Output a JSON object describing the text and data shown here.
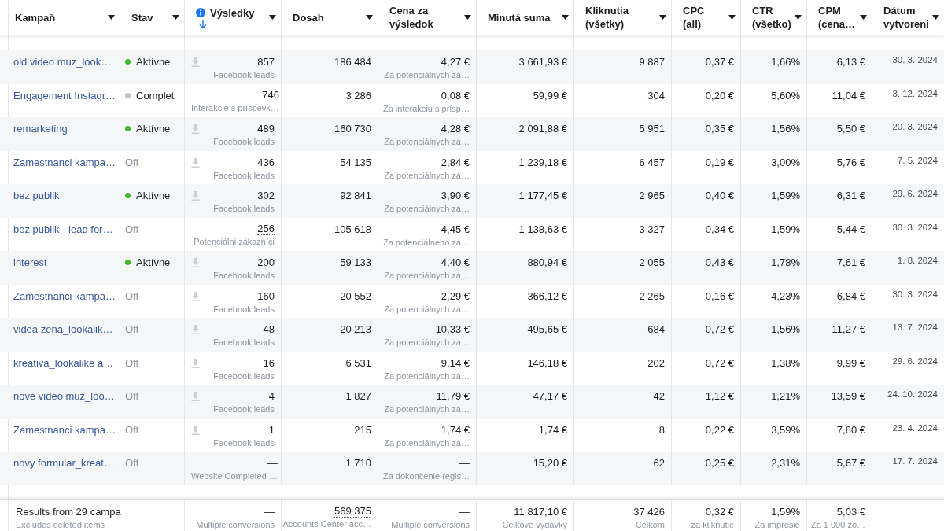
{
  "columns": [
    {
      "label": "Kampaň",
      "sorted": false
    },
    {
      "label": "Stav",
      "sorted": false
    },
    {
      "label": "Výsledky",
      "sorted": true
    },
    {
      "label": "Dosah",
      "sorted": false
    },
    {
      "label": "Cena za\nvýsledok",
      "sorted": false
    },
    {
      "label": "Minutá suma",
      "sorted": false
    },
    {
      "label": "Kliknutia\n(všetky)",
      "sorted": false
    },
    {
      "label": "CPC (all)",
      "sorted": false
    },
    {
      "label": "CTR\n(všetko)",
      "sorted": false
    },
    {
      "label": "CPM\n(cena…",
      "sorted": false
    },
    {
      "label": "Dátum\nvytvoreni",
      "sorted": false
    }
  ],
  "rows": [
    {
      "name": "old video muz_look…",
      "status": {
        "label": "Aktívne",
        "kind": "active"
      },
      "results": {
        "value": "857",
        "label": "Facebook leads",
        "download": true,
        "dotted": false
      },
      "reach": "186 484",
      "cost": {
        "value": "4,27 €",
        "label": "Za potenciálnych zá…"
      },
      "spent": "3 661,93 €",
      "clicks": "9 887",
      "cpc": "0,37 €",
      "ctr": "1,66%",
      "cpm": "6,13 €",
      "date": "30. 3. 2024"
    },
    {
      "name": "Engagement Instagr…",
      "status": {
        "label": "Complet",
        "kind": "completed"
      },
      "results": {
        "value": "746",
        "label": "Interakcie s príspevk…",
        "download": false,
        "dotted": true
      },
      "reach": "3 286",
      "cost": {
        "value": "0,08 €",
        "label": "Za interakciu s prísp…"
      },
      "spent": "59,99 €",
      "clicks": "304",
      "cpc": "0,20 €",
      "ctr": "5,60%",
      "cpm": "11,04 €",
      "date": "3. 12. 2024"
    },
    {
      "name": "remarketing",
      "status": {
        "label": "Aktívne",
        "kind": "active"
      },
      "results": {
        "value": "489",
        "label": "Facebook leads",
        "download": true,
        "dotted": false
      },
      "reach": "160 730",
      "cost": {
        "value": "4,28 €",
        "label": "Za potenciálnych zá…"
      },
      "spent": "2 091,88 €",
      "clicks": "5 951",
      "cpc": "0,35 €",
      "ctr": "1,56%",
      "cpm": "5,50 €",
      "date": "20. 3. 2024"
    },
    {
      "name": "Zamestnanci kampa…",
      "status": {
        "label": "Off",
        "kind": "off"
      },
      "results": {
        "value": "436",
        "label": "Facebook leads",
        "download": true,
        "dotted": false
      },
      "reach": "54 135",
      "cost": {
        "value": "2,84 €",
        "label": "Za potenciálnych zá…"
      },
      "spent": "1 239,18 €",
      "clicks": "6 457",
      "cpc": "0,19 €",
      "ctr": "3,00%",
      "cpm": "5,76 €",
      "date": "7. 5. 2024"
    },
    {
      "name": "bez publik",
      "status": {
        "label": "Aktívne",
        "kind": "active"
      },
      "results": {
        "value": "302",
        "label": "Facebook leads",
        "download": true,
        "dotted": false
      },
      "reach": "92 841",
      "cost": {
        "value": "3,90 €",
        "label": "Za potenciálnych zá…"
      },
      "spent": "1 177,45 €",
      "clicks": "2 965",
      "cpc": "0,40 €",
      "ctr": "1,59%",
      "cpm": "6,31 €",
      "date": "29. 6. 2024"
    },
    {
      "name": "bez publik - lead for…",
      "status": {
        "label": "Off",
        "kind": "off"
      },
      "results": {
        "value": "256",
        "label": "Potenciálni zákazníci",
        "download": false,
        "dotted": true
      },
      "reach": "105 618",
      "cost": {
        "value": "4,45 €",
        "label": "Za potenciálneho zá…"
      },
      "spent": "1 138,63 €",
      "clicks": "3 327",
      "cpc": "0,34 €",
      "ctr": "1,59%",
      "cpm": "5,44 €",
      "date": "30. 3. 2024"
    },
    {
      "name": "interest",
      "status": {
        "label": "Aktívne",
        "kind": "active"
      },
      "results": {
        "value": "200",
        "label": "Facebook leads",
        "download": true,
        "dotted": false
      },
      "reach": "59 133",
      "cost": {
        "value": "4,40 €",
        "label": "Za potenciálnych zá…"
      },
      "spent": "880,94 €",
      "clicks": "2 055",
      "cpc": "0,43 €",
      "ctr": "1,78%",
      "cpm": "7,61 €",
      "date": "1. 8. 2024"
    },
    {
      "name": "Zamestnanci kampa…",
      "status": {
        "label": "Off",
        "kind": "off"
      },
      "results": {
        "value": "160",
        "label": "Facebook leads",
        "download": true,
        "dotted": false
      },
      "reach": "20 552",
      "cost": {
        "value": "2,29 €",
        "label": "Za potenciálnych zá…"
      },
      "spent": "366,12 €",
      "clicks": "2 265",
      "cpc": "0,16 €",
      "ctr": "4,23%",
      "cpm": "6,84 €",
      "date": "30. 3. 2024"
    },
    {
      "name": "videa zena_lookalik…",
      "status": {
        "label": "Off",
        "kind": "off"
      },
      "results": {
        "value": "48",
        "label": "Facebook leads",
        "download": true,
        "dotted": false
      },
      "reach": "20 213",
      "cost": {
        "value": "10,33 €",
        "label": "Za potenciálnych zá…"
      },
      "spent": "495,65 €",
      "clicks": "684",
      "cpc": "0,72 €",
      "ctr": "1,56%",
      "cpm": "11,27 €",
      "date": "13. 7. 2024"
    },
    {
      "name": "kreativa_lookalike a…",
      "status": {
        "label": "Off",
        "kind": "off"
      },
      "results": {
        "value": "16",
        "label": "Facebook leads",
        "download": true,
        "dotted": false
      },
      "reach": "6 531",
      "cost": {
        "value": "9,14 €",
        "label": "Za potenciálnych zá…"
      },
      "spent": "146,18 €",
      "clicks": "202",
      "cpc": "0,72 €",
      "ctr": "1,38%",
      "cpm": "9,99 €",
      "date": "29. 6. 2024"
    },
    {
      "name": "nové video muz_loo…",
      "status": {
        "label": "Off",
        "kind": "off"
      },
      "results": {
        "value": "4",
        "label": "Facebook leads",
        "download": true,
        "dotted": false
      },
      "reach": "1 827",
      "cost": {
        "value": "11,79 €",
        "label": "Za potenciálnych zá…"
      },
      "spent": "47,17 €",
      "clicks": "42",
      "cpc": "1,12 €",
      "ctr": "1,21%",
      "cpm": "13,59 €",
      "date": "24. 10. 2024"
    },
    {
      "name": "Zamestnanci kampa…",
      "status": {
        "label": "Off",
        "kind": "off"
      },
      "results": {
        "value": "1",
        "label": "Facebook leads",
        "download": true,
        "dotted": false
      },
      "reach": "215",
      "cost": {
        "value": "1,74 €",
        "label": "Za potenciálnych zá…"
      },
      "spent": "1,74 €",
      "clicks": "8",
      "cpc": "0,22 €",
      "ctr": "3,59%",
      "cpm": "7,80 €",
      "date": "23. 4. 2024"
    },
    {
      "name": "novy formular_kreat…",
      "status": {
        "label": "Off",
        "kind": "off"
      },
      "results": {
        "value": "—",
        "label": "Website Completed …",
        "download": false,
        "dotted": false
      },
      "reach": "1 710",
      "cost": {
        "value": "—",
        "label": "Za dokončenie regis…"
      },
      "spent": "15,20 €",
      "clicks": "62",
      "cpc": "0,25 €",
      "ctr": "2,31%",
      "cpm": "5,67 €",
      "date": "17. 7. 2024"
    }
  ],
  "summary": {
    "title": "Results from 29 campa",
    "note": "Excludes deleted items",
    "cells": [
      {
        "value": "—",
        "label": "Multiple conversions",
        "dotted": false
      },
      {
        "value": "569 375",
        "label": "Accounts Center acc…",
        "dotted": true
      },
      {
        "value": "—",
        "label": "Multiple conversions",
        "dotted": false
      },
      {
        "value": "11 817,10 €",
        "label": "Celkové výdavky",
        "dotted": false
      },
      {
        "value": "37 426",
        "label": "Celkom",
        "dotted": false
      },
      {
        "value": "0,32 €",
        "label": "za kliknutie",
        "dotted": false
      },
      {
        "value": "1,59%",
        "label": "Za impresie",
        "dotted": false
      },
      {
        "value": "5,03 €",
        "label": "Za 1 000 zo…",
        "dotted": false
      }
    ]
  }
}
